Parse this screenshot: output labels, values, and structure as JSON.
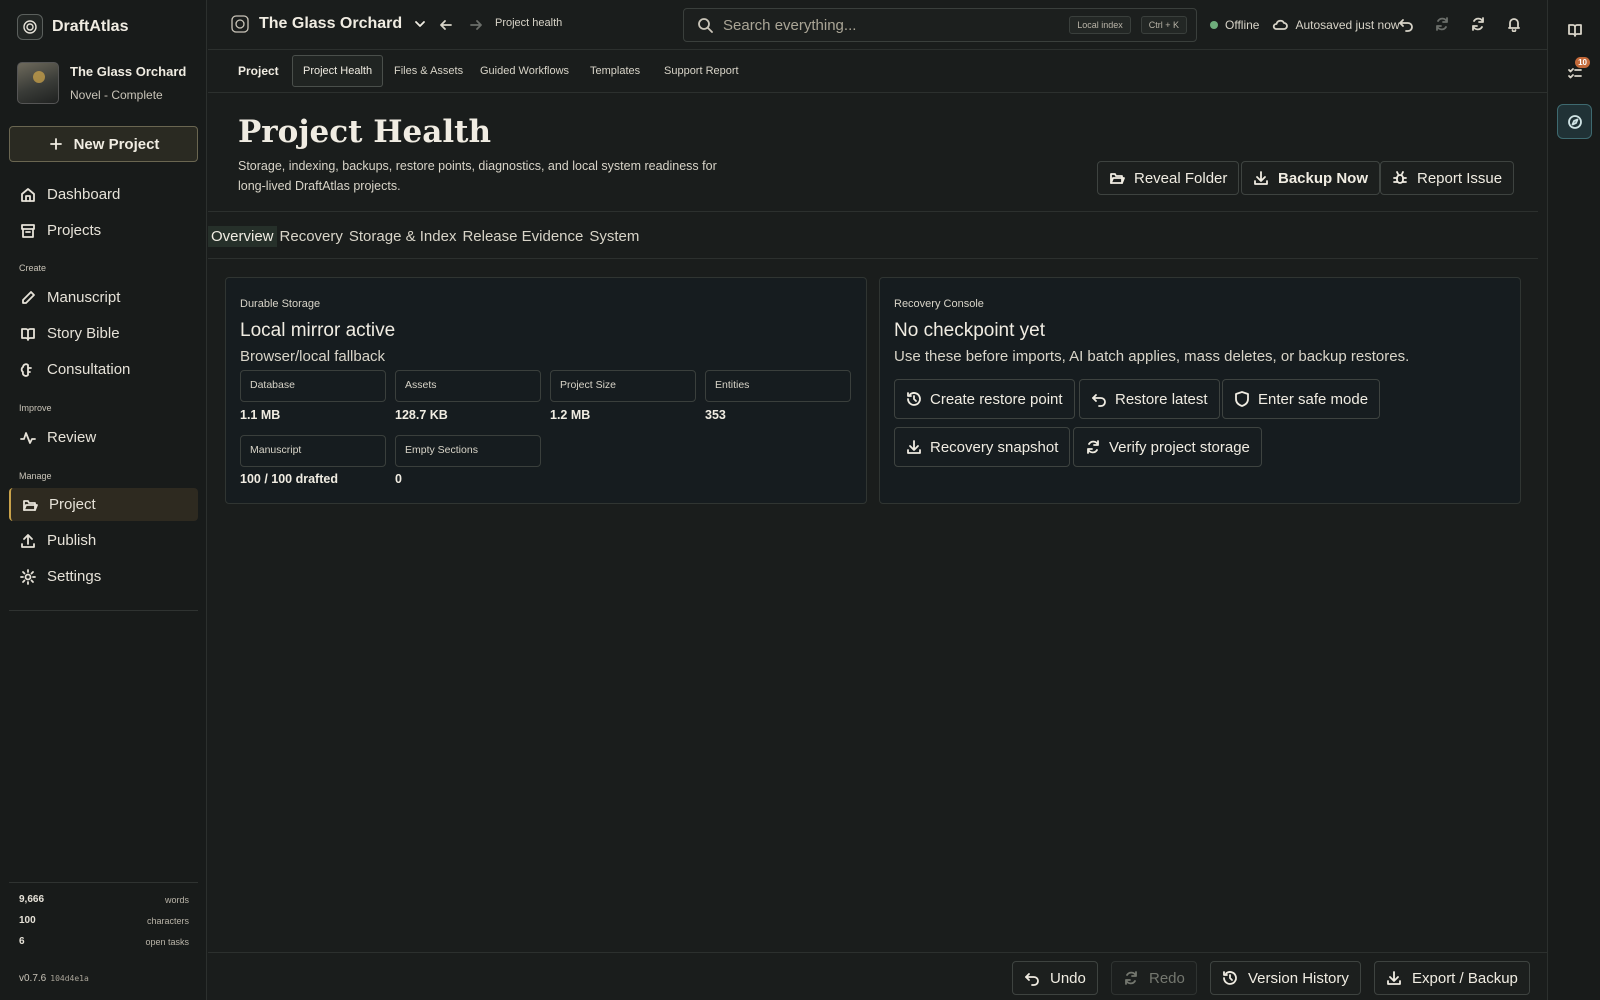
{
  "app": {
    "name": "DraftAtlas",
    "version": "v0.7.6",
    "build_hash": "104d4e1a"
  },
  "project": {
    "name": "The Glass Orchard",
    "subtitle": "Novel - Complete"
  },
  "sidebar": {
    "new_project_label": "New Project",
    "items": [
      {
        "label": "Dashboard",
        "icon": "home-icon"
      },
      {
        "label": "Projects",
        "icon": "archive-icon"
      },
      {
        "label": "Manuscript",
        "icon": "pen-icon"
      },
      {
        "label": "Story Bible",
        "icon": "book-icon"
      },
      {
        "label": "Consultation",
        "icon": "brain-icon"
      },
      {
        "label": "Review",
        "icon": "activity-icon"
      },
      {
        "label": "Project",
        "icon": "folder-open-icon"
      },
      {
        "label": "Publish",
        "icon": "upload-icon"
      },
      {
        "label": "Settings",
        "icon": "gear-icon"
      }
    ],
    "sections": [
      "Create",
      "Improve",
      "Manage"
    ],
    "stats": [
      {
        "value": "9,666",
        "label": "words"
      },
      {
        "value": "100",
        "label": "characters"
      },
      {
        "value": "6",
        "label": "open tasks"
      }
    ]
  },
  "topbar": {
    "breadcrumb": "Project health",
    "search_placeholder": "Search everything...",
    "local_index_label": "Local index",
    "shortcut": "Ctrl + K",
    "status": "Offline",
    "autosave": "Autosaved just now"
  },
  "rail": {
    "notification_count": "10"
  },
  "subtabs": [
    "Project",
    "Project Health",
    "Files & Assets",
    "Guided Workflows",
    "Templates",
    "Support Report"
  ],
  "header": {
    "title": "Project Health",
    "description": "Storage, indexing, backups, restore points, diagnostics, and local system readiness for long-lived DraftAtlas projects.",
    "buttons": [
      "Reveal Folder",
      "Backup Now",
      "Report Issue"
    ]
  },
  "section_tabs": [
    "Overview",
    "Recovery",
    "Storage & Index",
    "Release Evidence",
    "System"
  ],
  "storage_card": {
    "eyebrow": "Durable Storage",
    "title": "Local mirror active",
    "subtitle": "Browser/local fallback",
    "metrics": [
      {
        "label": "Database",
        "value": "1.1 MB"
      },
      {
        "label": "Assets",
        "value": "128.7 KB"
      },
      {
        "label": "Project Size",
        "value": "1.2 MB"
      },
      {
        "label": "Entities",
        "value": "353"
      },
      {
        "label": "Manuscript",
        "value": "100 / 100 drafted"
      },
      {
        "label": "Empty Sections",
        "value": "0"
      }
    ]
  },
  "recovery_card": {
    "eyebrow": "Recovery Console",
    "title": "No checkpoint yet",
    "subtitle": "Use these before imports, AI batch applies, mass deletes, or backup restores.",
    "actions": [
      "Create restore point",
      "Restore latest",
      "Enter safe mode",
      "Recovery snapshot",
      "Verify project storage"
    ]
  },
  "bottombar": {
    "undo": "Undo",
    "redo": "Redo",
    "history": "Version History",
    "export": "Export / Backup"
  },
  "colors": {
    "accent": "#c9a24a",
    "background": "#1a1d1c",
    "online_dot": "#6fae7c",
    "badge": "#c46a3a"
  }
}
